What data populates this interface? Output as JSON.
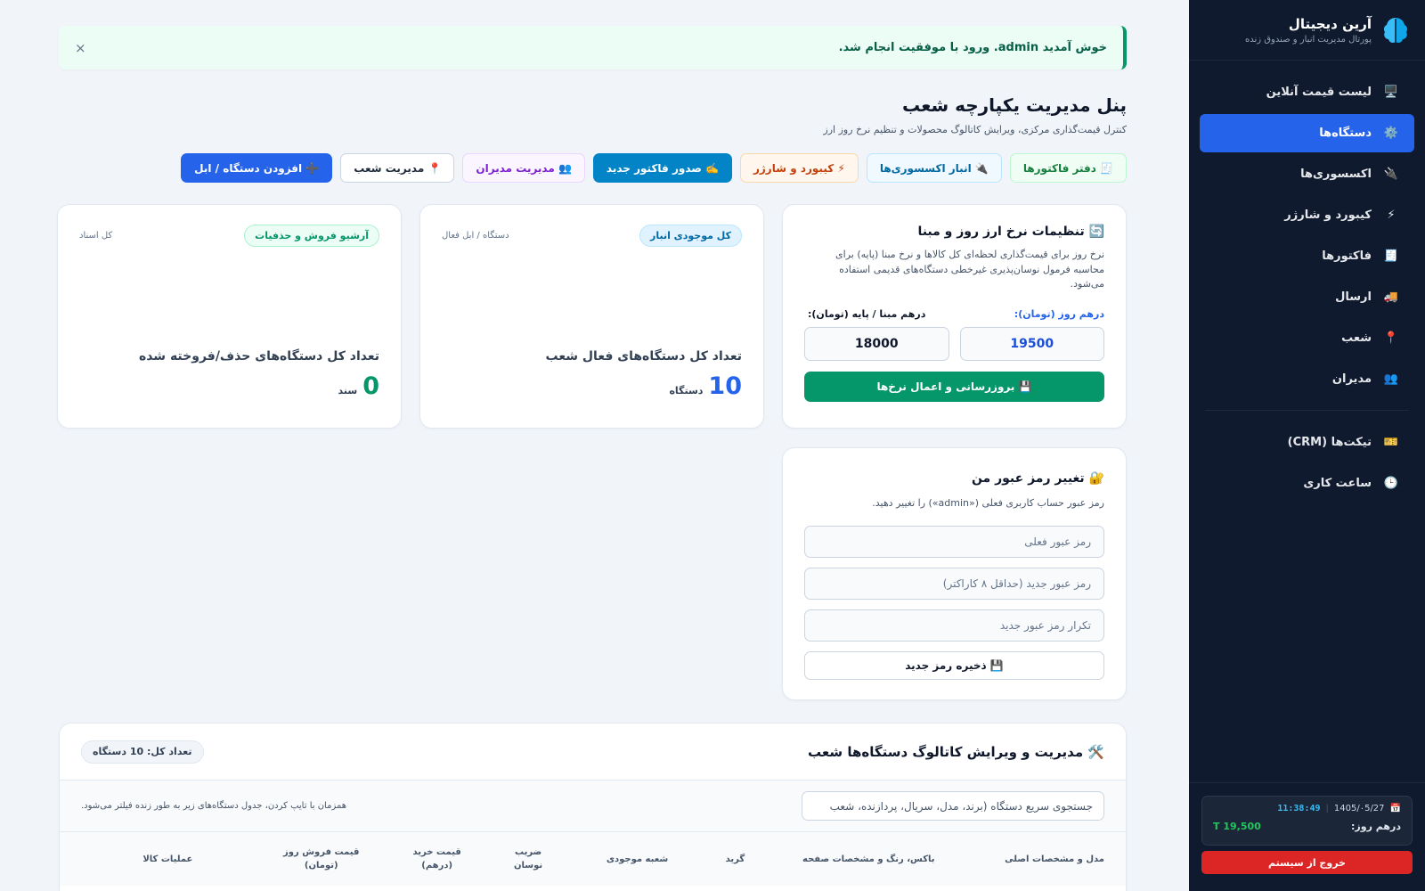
{
  "brand": {
    "title": "آرین دیجیتال",
    "subtitle": "پورتال مدیریت انبار و صندوق زنده"
  },
  "sidebar": {
    "items": [
      {
        "icon": "🖥️",
        "label": "لیست قیمت آنلاین"
      },
      {
        "icon": "⚙️",
        "label": "دستگاه‌ها",
        "active": true
      },
      {
        "icon": "🔌",
        "label": "اکسسوری‌ها"
      },
      {
        "icon": "⚡",
        "label": "کیبورد و شارژر"
      },
      {
        "icon": "🧾",
        "label": "فاکتورها"
      },
      {
        "icon": "🚚",
        "label": "ارسال"
      },
      {
        "icon": "📍",
        "label": "شعب"
      },
      {
        "icon": "👥",
        "label": "مدیران"
      }
    ],
    "extra_items": [
      {
        "icon": "🎫",
        "label": "تیکت‌ها (CRM)"
      },
      {
        "icon": "🕒",
        "label": "ساعت کاری"
      }
    ],
    "clock": {
      "date_icon": "📅",
      "date": "1405/۰5/27",
      "separator": "|",
      "time": "11:38:49"
    },
    "dirham": {
      "label": "درهم روز:",
      "value": "T 19,500"
    },
    "logout_label": "خروج از سیستم"
  },
  "alert": {
    "text": "خوش آمدید admin. ورود با موفقیت انجام شد.",
    "close": "×"
  },
  "page": {
    "title": "پنل مدیریت یکپارچه شعب",
    "subtitle": "کنترل قیمت‌گذاری مرکزی، ویرایش کاتالوگ محصولات و تنظیم نرخ روز ارز"
  },
  "toolbar": [
    {
      "label": "🧾 دفتر فاکتورها",
      "style": "green"
    },
    {
      "label": "🔌 انبار اکسسوری‌ها",
      "style": "blue-l"
    },
    {
      "label": "⚡ کیبورد و شارژر",
      "style": "orange"
    },
    {
      "label": "✍️ صدور فاکتور جدید",
      "style": "teal"
    },
    {
      "label": "👥 مدیریت مدیران",
      "style": "purple"
    },
    {
      "label": "📍 مدیریت شعب",
      "style": "white"
    },
    {
      "label": "➕ افزودن دستگاه / ابل",
      "style": "primary"
    }
  ],
  "fx_card": {
    "title": "🔄 تنظیمات نرخ ارز روز و مبنا",
    "description": "نرخ روز برای قیمت‌گذاری لحظه‌ای کل کالاها و نرخ مبنا (پایه) برای محاسبه فرمول نوسان‌پذیری غیرخطی دستگاه‌های قدیمی استفاده می‌شود.",
    "label_daily": "درهم روز (تومان):",
    "label_base": "درهم مبنا / پایه (تومان):",
    "value_daily": "19500",
    "value_base": "18000",
    "button": "💾 بروزرسانی و اعمال نرخ‌ها"
  },
  "stats": [
    {
      "badge": "کل موجودی انبار",
      "small": "دستگاه / ابل فعال",
      "label": "تعداد کل دستگاه‌های فعال شعب",
      "value": "10",
      "unit": "دستگاه"
    },
    {
      "badge": "آرشیو فروش و حذفیات",
      "small": "کل اسناد",
      "label": "تعداد کل دستگاه‌های حذف/فروخته شده",
      "value": "0",
      "unit": "سند"
    }
  ],
  "password_card": {
    "title": "🔐 تغییر رمز عبور من",
    "description": "رمز عبور حساب کاربری فعلی («admin») را تغییر دهید.",
    "placeholder_current": "رمز عبور فعلی",
    "placeholder_new": "رمز عبور جدید (حداقل ۸ کاراکتر)",
    "placeholder_repeat": "تکرار رمز عبور جدید",
    "button": "💾 ذخیره رمز جدید"
  },
  "catalog": {
    "title": "🛠️ مدیریت و ویرایش کاتالوگ دستگاه‌ها شعب",
    "count_badge": "تعداد کل: 10 دستگاه",
    "search_placeholder": "جستجوی سریع دستگاه (برند، مدل، سریال، پردازنده، شعب",
    "search_hint": "همزمان با تایپ کردن، جدول دستگاه‌های زیر به طور زنده فیلتر می‌شود.",
    "columns": [
      "مدل و مشخصات اصلی",
      "باکس، رنگ و مشخصات صفحه",
      "گرید",
      "شعبه موجودی",
      "ضریب نوسان",
      "قیمت خرید (درهم)",
      "قیمت فروش روز (تومان)",
      "عملیات کالا"
    ]
  }
}
